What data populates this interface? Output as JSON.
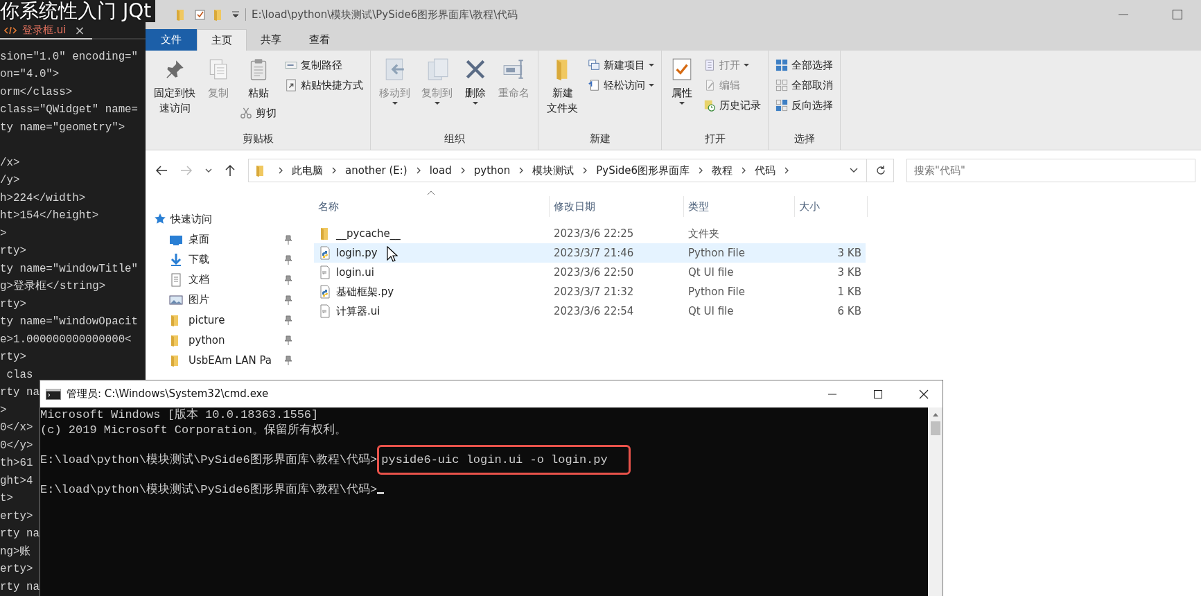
{
  "caption": "你系统性入门 JQt",
  "editor": {
    "tab": {
      "label": "登录框.ui",
      "close": "×"
    },
    "lines": [
      {
        "text": "sion=\"1.0\" encoding=\""
      },
      {
        "text": "on=\"4.0\">"
      },
      {
        "text": "orm</class>"
      },
      {
        "text": "class=\"QWidget\" name="
      },
      {
        "text": "ty name=\"geometry\">"
      },
      {
        "text": "/x>",
        "gap_before": true
      },
      {
        "text": "/y>"
      },
      {
        "text": "h>224</width>"
      },
      {
        "text": "ht>154</height>"
      },
      {
        "text": ">"
      },
      {
        "text": "rty>"
      },
      {
        "text": "ty name=\"windowTitle\""
      },
      {
        "text": "g>登录框</string>"
      },
      {
        "text": "rty>"
      },
      {
        "text": "ty name=\"windowOpacit"
      },
      {
        "text": "e>1.000000000000000<"
      },
      {
        "text": "rty>"
      },
      {
        "text": " clas"
      },
      {
        "text": "rty na"
      },
      {
        "text": ">"
      },
      {
        "text": "0</x>"
      },
      {
        "text": "0</y>"
      },
      {
        "text": "th>61"
      },
      {
        "text": "ght>4"
      },
      {
        "text": "t>"
      },
      {
        "text": "erty>"
      },
      {
        "text": "rty na"
      },
      {
        "text": "ng>账"
      },
      {
        "text": "erty>"
      },
      {
        "text": "rty na"
      }
    ]
  },
  "explorer": {
    "title": "E:\\load\\python\\模块测试\\PySide6图形界面库\\教程\\代码",
    "ribbon_tabs": [
      {
        "label": "文件",
        "kind": "file",
        "selected": false
      },
      {
        "label": "主页",
        "kind": "tab",
        "selected": true
      },
      {
        "label": "共享",
        "kind": "tab",
        "selected": false
      },
      {
        "label": "查看",
        "kind": "tab",
        "selected": false
      }
    ],
    "ribbon_groups": [
      {
        "label": "剪贴板",
        "columns": [
          [
            {
              "kind": "large",
              "label": [
                "固定到快",
                "速访问"
              ],
              "disabled": false
            }
          ],
          [
            {
              "kind": "large",
              "label": "复制",
              "disabled": true
            }
          ],
          [
            {
              "kind": "large",
              "label": "粘贴",
              "disabled": false
            },
            {
              "kind": "small",
              "label": "剪切",
              "disabled": false
            }
          ],
          [
            {
              "kind": "small",
              "label": "复制路径",
              "disabled": false
            },
            {
              "kind": "small",
              "label": "粘贴快捷方式",
              "disabled": false
            }
          ]
        ]
      },
      {
        "label": "组织",
        "columns": [
          [
            {
              "kind": "large",
              "label": "移动到",
              "disabled": true,
              "dropdown": true
            }
          ],
          [
            {
              "kind": "large",
              "label": "复制到",
              "disabled": true,
              "dropdown": true
            }
          ],
          [
            {
              "kind": "large",
              "label": "删除",
              "disabled": false,
              "dropdown": true
            }
          ],
          [
            {
              "kind": "large",
              "label": "重命名",
              "disabled": true
            }
          ]
        ]
      },
      {
        "label": "新建",
        "columns": [
          [
            {
              "kind": "large",
              "label": [
                "新建",
                "文件夹"
              ],
              "disabled": false
            }
          ],
          [
            {
              "kind": "small",
              "label": "新建项目",
              "disabled": false,
              "dropdown": true
            },
            {
              "kind": "small",
              "label": "轻松访问",
              "disabled": false,
              "dropdown": true
            }
          ]
        ]
      },
      {
        "label": "打开",
        "columns": [
          [
            {
              "kind": "large",
              "label": "属性",
              "disabled": false,
              "dropdown": true
            }
          ],
          [
            {
              "kind": "small",
              "label": "打开",
              "disabled": true,
              "dropdown": true
            },
            {
              "kind": "small",
              "label": "编辑",
              "disabled": true
            },
            {
              "kind": "small",
              "label": "历史记录",
              "disabled": false
            }
          ]
        ]
      },
      {
        "label": "选择",
        "columns": [
          [
            {
              "kind": "small",
              "label": "全部选择",
              "disabled": false
            },
            {
              "kind": "small",
              "label": "全部取消",
              "disabled": false
            },
            {
              "kind": "small",
              "label": "反向选择",
              "disabled": false
            }
          ]
        ]
      }
    ],
    "breadcrumbs": [
      "此电脑",
      "another (E:)",
      "load",
      "python",
      "模块测试",
      "PySide6图形界面库",
      "教程",
      "代码"
    ],
    "search": {
      "placeholder": "搜索\"代码\""
    },
    "nav": {
      "header": "快速访问",
      "items": [
        {
          "label": "桌面",
          "pinned": true
        },
        {
          "label": "下载",
          "pinned": true
        },
        {
          "label": "文档",
          "pinned": true
        },
        {
          "label": "图片",
          "pinned": true
        },
        {
          "label": "picture",
          "pinned": true
        },
        {
          "label": "python",
          "pinned": true
        },
        {
          "label": "UsbEAm LAN Pa",
          "pinned": true
        }
      ]
    },
    "columns": [
      "名称",
      "修改日期",
      "类型",
      "大小"
    ],
    "files": [
      {
        "name": "__pycache__",
        "kind": "folder",
        "date": "2023/3/6 22:25",
        "type": "文件夹",
        "selected": false
      },
      {
        "name": "login.py",
        "kind": "py",
        "date": "2023/3/7 21:46",
        "type": "Python File",
        "size": "3 KB",
        "selected": true
      },
      {
        "name": "login.ui",
        "kind": "ui",
        "date": "2023/3/6 22:50",
        "type": "Qt UI file",
        "size": "3 KB",
        "selected": false
      },
      {
        "name": "基础框架.py",
        "kind": "py",
        "date": "2023/3/7 21:32",
        "type": "Python File",
        "size": "1 KB",
        "selected": false
      },
      {
        "name": "计算器.ui",
        "kind": "ui",
        "date": "2023/3/6 22:54",
        "type": "Qt UI file",
        "size": "6 KB",
        "selected": false
      }
    ]
  },
  "cmd": {
    "title": "管理员: C:\\Windows\\System32\\cmd.exe",
    "lines": [
      {
        "kind": "output",
        "text": "Microsoft Windows [版本 10.0.18363.1556]"
      },
      {
        "kind": "output",
        "text": "(c) 2019 Microsoft Corporation。保留所有权利。"
      },
      {
        "kind": "prompt",
        "prompt": "E:\\load\\python\\模块测试\\PySide6图形界面库\\教程\\代码>",
        "command": "pyside6-uic login.ui -o login.py",
        "highlighted": true
      },
      {
        "kind": "prompt",
        "prompt": "E:\\load\\python\\模块测试\\PySide6图形界面库\\教程\\代码>",
        "cursor": true
      }
    ]
  }
}
